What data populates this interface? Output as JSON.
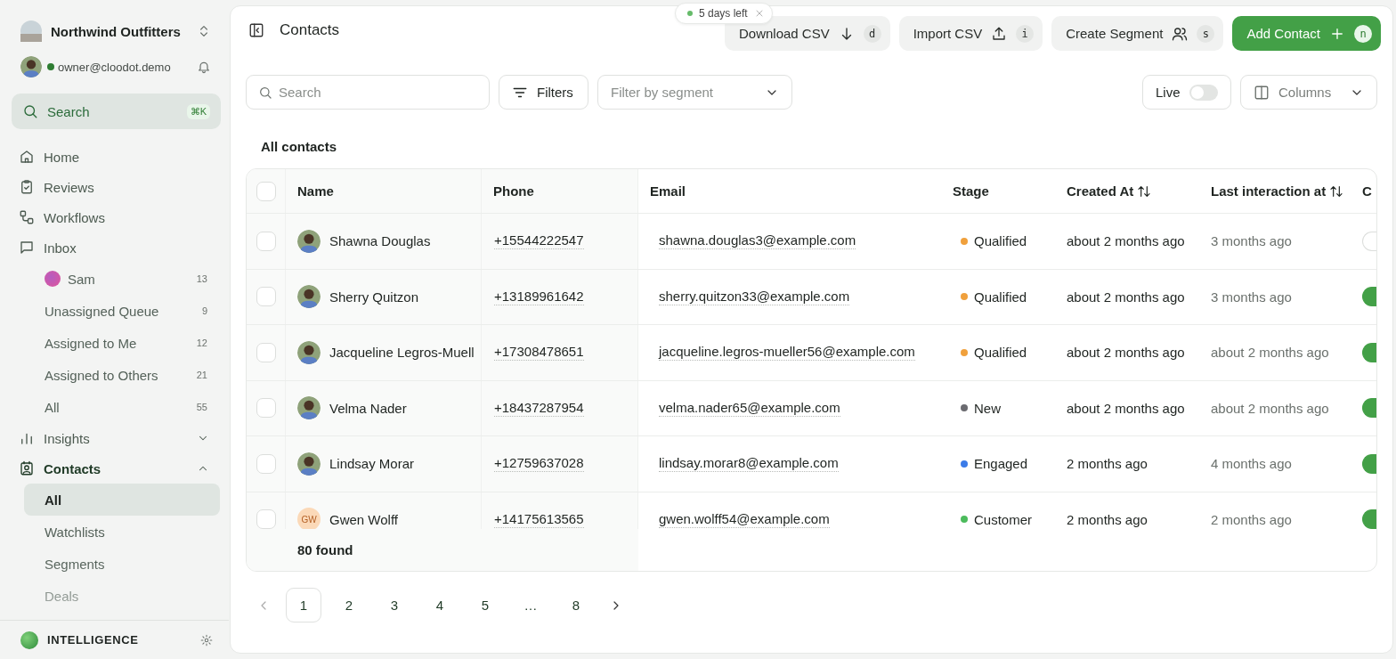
{
  "sidebar": {
    "workspace": "Northwind Outfitters",
    "user": {
      "email": "owner@cloodot.demo",
      "online": true
    },
    "search": {
      "label": "Search",
      "shortcut": "⌘K"
    },
    "nav": [
      {
        "label": "Home"
      },
      {
        "label": "Reviews"
      },
      {
        "label": "Workflows"
      },
      {
        "label": "Inbox",
        "children": [
          {
            "label": "Sam",
            "count": "13",
            "avatar": true,
            "selected": false
          },
          {
            "label": "Unassigned Queue",
            "count": "9",
            "selected": false
          },
          {
            "label": "Assigned to Me",
            "count": "12",
            "selected": false
          },
          {
            "label": "Assigned to Others",
            "count": "21",
            "selected": false
          },
          {
            "label": "All",
            "count": "55",
            "selected": false
          }
        ]
      },
      {
        "label": "Insights",
        "expanded": false
      },
      {
        "label": "Contacts",
        "expanded": true,
        "children": [
          {
            "label": "All",
            "selected": true
          },
          {
            "label": "Watchlists",
            "selected": false
          },
          {
            "label": "Segments",
            "selected": false
          },
          {
            "label": "Deals",
            "selected": false
          }
        ]
      }
    ],
    "footer": {
      "label": "INTELLIGENCE"
    }
  },
  "header": {
    "title": "Contacts",
    "trial_badge": "5 days left",
    "actions": [
      {
        "label": "Download CSV",
        "key": "d",
        "kind": "secondary"
      },
      {
        "label": "Import CSV",
        "key": "i",
        "kind": "secondary"
      },
      {
        "label": "Create Segment",
        "key": "s",
        "kind": "secondary"
      },
      {
        "label": "Add Contact",
        "key": "n",
        "kind": "primary"
      }
    ]
  },
  "filters": {
    "search": {
      "placeholder": "Search"
    },
    "filters_button": "Filters",
    "segment": {
      "placeholder": "Filter by segment"
    },
    "live": {
      "label": "Live",
      "on": false
    },
    "columns": "Columns"
  },
  "section_title": "All contacts",
  "table": {
    "select_all_checked": false,
    "columns": [
      "Name",
      "Phone",
      "Email",
      "Stage",
      "Created At",
      "Last interaction at",
      "C"
    ],
    "rows": [
      {
        "name": "Shawna Douglas",
        "avatar": {
          "kind": "photo"
        },
        "phone": "+15544222547",
        "email": "shawna.douglas3@example.com",
        "stage": {
          "label": "Qualified",
          "color": "#f0a03c"
        },
        "created": "about 2 months ago",
        "last": "3 months ago",
        "checked": false,
        "column_7_on": false
      },
      {
        "name": "Sherry Quitzon",
        "avatar": {
          "kind": "photo"
        },
        "phone": "+13189961642",
        "email": "sherry.quitzon33@example.com",
        "stage": {
          "label": "Qualified",
          "color": "#f0a03c"
        },
        "created": "about 2 months ago",
        "last": "3 months ago",
        "checked": false,
        "column_7_on": true
      },
      {
        "name": "Jacqueline Legros-Muell",
        "avatar": {
          "kind": "photo"
        },
        "phone": "+17308478651",
        "email": "jacqueline.legros-mueller56@example.com",
        "stage": {
          "label": "Qualified",
          "color": "#f0a03c"
        },
        "created": "about 2 months ago",
        "last": "about 2 months ago",
        "checked": false,
        "column_7_on": true
      },
      {
        "name": "Velma Nader",
        "avatar": {
          "kind": "photo"
        },
        "phone": "+18437287954",
        "email": "velma.nader65@example.com",
        "stage": {
          "label": "New",
          "color": "#6b6b70"
        },
        "created": "about 2 months ago",
        "last": "about 2 months ago",
        "checked": false,
        "column_7_on": true
      },
      {
        "name": "Lindsay Morar",
        "avatar": {
          "kind": "photo"
        },
        "phone": "+12759637028",
        "email": "lindsay.morar8@example.com",
        "stage": {
          "label": "Engaged",
          "color": "#3b7be8"
        },
        "created": "2 months ago",
        "last": "4 months ago",
        "checked": false,
        "column_7_on": true
      },
      {
        "name": "Gwen Wolff",
        "avatar": {
          "kind": "initials",
          "initials": "GW"
        },
        "phone": "+14175613565",
        "email": "gwen.wolff54@example.com",
        "stage": {
          "label": "Customer",
          "color": "#4cbb5c"
        },
        "created": "2 months ago",
        "last": "2 months ago",
        "checked": false,
        "column_7_on": true
      }
    ],
    "found": "80 found"
  },
  "pagination": {
    "pages": [
      {
        "label": "1",
        "selected": true
      },
      {
        "label": "2",
        "selected": false
      },
      {
        "label": "3",
        "selected": false
      },
      {
        "label": "4",
        "selected": false
      },
      {
        "label": "5",
        "selected": false
      },
      {
        "label": "…",
        "selected": false
      },
      {
        "label": "8",
        "selected": false
      }
    ]
  }
}
